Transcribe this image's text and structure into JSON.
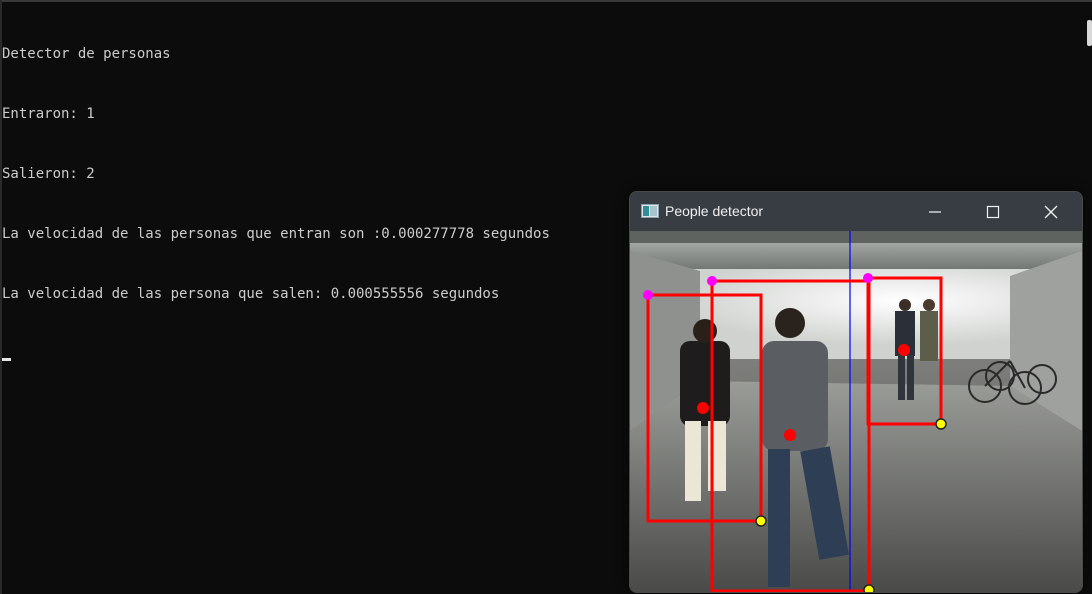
{
  "console": {
    "lines": [
      "Detector de personas",
      "Entraron: 1",
      "Salieron: 2",
      "La velocidad de las personas que entran son :0.000277778 segundos",
      "La velocidad de las persona que salen: 0.000555556 segundos"
    ]
  },
  "window": {
    "title": "People detector",
    "icon": "app-window-icon",
    "controls": [
      "minimize-icon",
      "maximize-icon",
      "close-icon"
    ]
  },
  "colors": {
    "console_bg": "#0c0c0c",
    "console_text": "#cccccc",
    "box": "#ff0000",
    "line": "#0000ff",
    "top_marker": "#ff00ff",
    "bottom_marker": "#ffff00"
  }
}
